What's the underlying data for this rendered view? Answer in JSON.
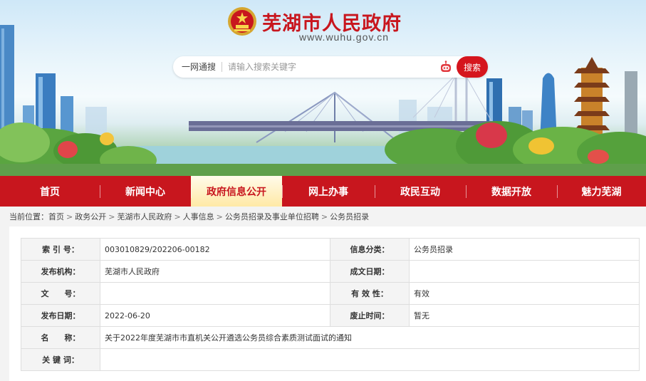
{
  "site": {
    "title": "芜湖市人民政府",
    "url": "www.wuhu.gov.cn"
  },
  "search": {
    "label": "一网通搜",
    "placeholder": "请输入搜索关键字",
    "button": "搜索",
    "robot_icon": "robot-icon"
  },
  "nav": {
    "items": [
      {
        "label": "首页"
      },
      {
        "label": "新闻中心"
      },
      {
        "label": "政府信息公开"
      },
      {
        "label": "网上办事"
      },
      {
        "label": "政民互动"
      },
      {
        "label": "数据开放"
      },
      {
        "label": "魅力芜湖"
      }
    ],
    "active_index": 2
  },
  "breadcrumb": {
    "prefix": "当前位置：",
    "items": [
      "首页",
      "政务公开",
      "芜湖市人民政府",
      "人事信息",
      "公务员招录及事业单位招聘",
      "公务员招录"
    ],
    "separator": ">"
  },
  "info": {
    "index_label": "索 引 号：",
    "index_value": "003010829/202206-00182",
    "category_label": "信息分类：",
    "category_value": "公务员招录",
    "publisher_label": "发布机构：",
    "publisher_value": "芜湖市人民政府",
    "created_label": "成文日期：",
    "created_value": "",
    "docno_label": "文　　号：",
    "docno_value": "",
    "validity_label": "有 效 性：",
    "validity_value": "有效",
    "pubdate_label": "发布日期：",
    "pubdate_value": "2022-06-20",
    "expire_label": "废止时间：",
    "expire_value": "暂无",
    "name_label": "名　　称：",
    "name_value": "关于2022年度芜湖市市直机关公开遴选公务员综合素质测试面试的通知",
    "keywords_label": "关 键 词：",
    "keywords_value": ""
  },
  "colors": {
    "brand_red": "#c8161e",
    "active_tab": "#ffe9a6"
  }
}
